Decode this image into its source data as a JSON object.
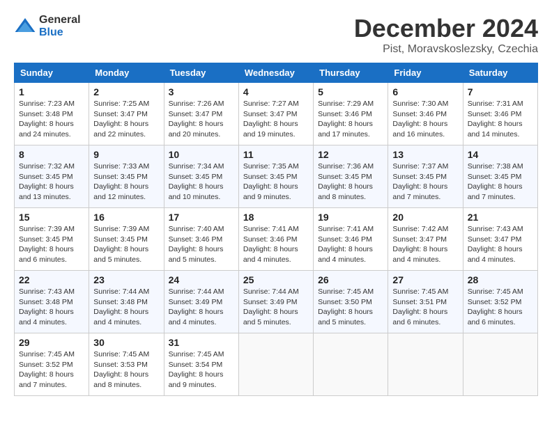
{
  "logo": {
    "general": "General",
    "blue": "Blue"
  },
  "header": {
    "month": "December 2024",
    "location": "Pist, Moravskoslezsky, Czechia"
  },
  "weekdays": [
    "Sunday",
    "Monday",
    "Tuesday",
    "Wednesday",
    "Thursday",
    "Friday",
    "Saturday"
  ],
  "weeks": [
    [
      {
        "day": "1",
        "sunrise": "7:23 AM",
        "sunset": "3:48 PM",
        "daylight": "8 hours and 24 minutes."
      },
      {
        "day": "2",
        "sunrise": "7:25 AM",
        "sunset": "3:47 PM",
        "daylight": "8 hours and 22 minutes."
      },
      {
        "day": "3",
        "sunrise": "7:26 AM",
        "sunset": "3:47 PM",
        "daylight": "8 hours and 20 minutes."
      },
      {
        "day": "4",
        "sunrise": "7:27 AM",
        "sunset": "3:47 PM",
        "daylight": "8 hours and 19 minutes."
      },
      {
        "day": "5",
        "sunrise": "7:29 AM",
        "sunset": "3:46 PM",
        "daylight": "8 hours and 17 minutes."
      },
      {
        "day": "6",
        "sunrise": "7:30 AM",
        "sunset": "3:46 PM",
        "daylight": "8 hours and 16 minutes."
      },
      {
        "day": "7",
        "sunrise": "7:31 AM",
        "sunset": "3:46 PM",
        "daylight": "8 hours and 14 minutes."
      }
    ],
    [
      {
        "day": "8",
        "sunrise": "7:32 AM",
        "sunset": "3:45 PM",
        "daylight": "8 hours and 13 minutes."
      },
      {
        "day": "9",
        "sunrise": "7:33 AM",
        "sunset": "3:45 PM",
        "daylight": "8 hours and 12 minutes."
      },
      {
        "day": "10",
        "sunrise": "7:34 AM",
        "sunset": "3:45 PM",
        "daylight": "8 hours and 10 minutes."
      },
      {
        "day": "11",
        "sunrise": "7:35 AM",
        "sunset": "3:45 PM",
        "daylight": "8 hours and 9 minutes."
      },
      {
        "day": "12",
        "sunrise": "7:36 AM",
        "sunset": "3:45 PM",
        "daylight": "8 hours and 8 minutes."
      },
      {
        "day": "13",
        "sunrise": "7:37 AM",
        "sunset": "3:45 PM",
        "daylight": "8 hours and 7 minutes."
      },
      {
        "day": "14",
        "sunrise": "7:38 AM",
        "sunset": "3:45 PM",
        "daylight": "8 hours and 7 minutes."
      }
    ],
    [
      {
        "day": "15",
        "sunrise": "7:39 AM",
        "sunset": "3:45 PM",
        "daylight": "8 hours and 6 minutes."
      },
      {
        "day": "16",
        "sunrise": "7:39 AM",
        "sunset": "3:45 PM",
        "daylight": "8 hours and 5 minutes."
      },
      {
        "day": "17",
        "sunrise": "7:40 AM",
        "sunset": "3:46 PM",
        "daylight": "8 hours and 5 minutes."
      },
      {
        "day": "18",
        "sunrise": "7:41 AM",
        "sunset": "3:46 PM",
        "daylight": "8 hours and 4 minutes."
      },
      {
        "day": "19",
        "sunrise": "7:41 AM",
        "sunset": "3:46 PM",
        "daylight": "8 hours and 4 minutes."
      },
      {
        "day": "20",
        "sunrise": "7:42 AM",
        "sunset": "3:47 PM",
        "daylight": "8 hours and 4 minutes."
      },
      {
        "day": "21",
        "sunrise": "7:43 AM",
        "sunset": "3:47 PM",
        "daylight": "8 hours and 4 minutes."
      }
    ],
    [
      {
        "day": "22",
        "sunrise": "7:43 AM",
        "sunset": "3:48 PM",
        "daylight": "8 hours and 4 minutes."
      },
      {
        "day": "23",
        "sunrise": "7:44 AM",
        "sunset": "3:48 PM",
        "daylight": "8 hours and 4 minutes."
      },
      {
        "day": "24",
        "sunrise": "7:44 AM",
        "sunset": "3:49 PM",
        "daylight": "8 hours and 4 minutes."
      },
      {
        "day": "25",
        "sunrise": "7:44 AM",
        "sunset": "3:49 PM",
        "daylight": "8 hours and 5 minutes."
      },
      {
        "day": "26",
        "sunrise": "7:45 AM",
        "sunset": "3:50 PM",
        "daylight": "8 hours and 5 minutes."
      },
      {
        "day": "27",
        "sunrise": "7:45 AM",
        "sunset": "3:51 PM",
        "daylight": "8 hours and 6 minutes."
      },
      {
        "day": "28",
        "sunrise": "7:45 AM",
        "sunset": "3:52 PM",
        "daylight": "8 hours and 6 minutes."
      }
    ],
    [
      {
        "day": "29",
        "sunrise": "7:45 AM",
        "sunset": "3:52 PM",
        "daylight": "8 hours and 7 minutes."
      },
      {
        "day": "30",
        "sunrise": "7:45 AM",
        "sunset": "3:53 PM",
        "daylight": "8 hours and 8 minutes."
      },
      {
        "day": "31",
        "sunrise": "7:45 AM",
        "sunset": "3:54 PM",
        "daylight": "8 hours and 9 minutes."
      },
      null,
      null,
      null,
      null
    ]
  ],
  "labels": {
    "sunrise": "Sunrise:",
    "sunset": "Sunset:",
    "daylight": "Daylight:"
  }
}
